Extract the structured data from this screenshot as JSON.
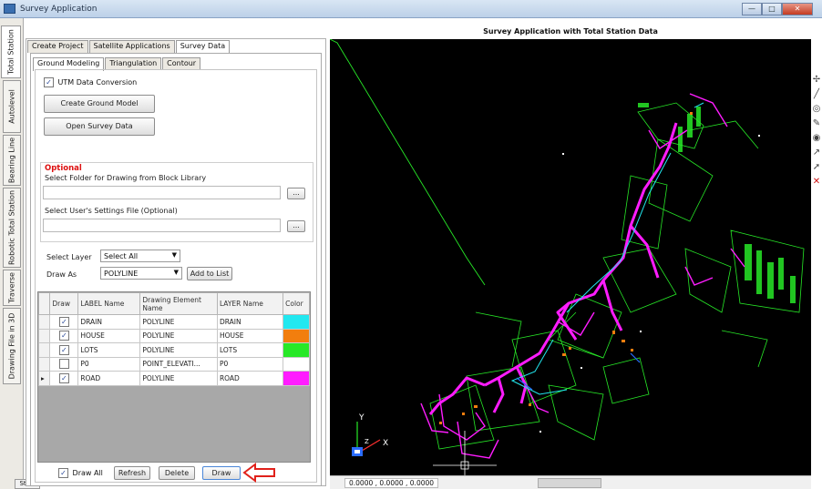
{
  "window": {
    "title": "Survey Application",
    "buttons": {
      "minimize": "—",
      "maximize": "□",
      "close": "✕"
    }
  },
  "side_tabs": [
    "Total Station",
    "Autolevel",
    "Bearing Line",
    "Robotic Total Station",
    "Traverse",
    "Drawing File in 3D"
  ],
  "start_button": "Start",
  "top_tabs": [
    "Create Project",
    "Satellite Applications",
    "Survey Data"
  ],
  "sub_tabs": [
    "Ground Modeling",
    "Triangulation",
    "Contour"
  ],
  "utm_label": "UTM Data Conversion",
  "utm_checked": "✓",
  "buttons": {
    "create_ground": "Create Ground Model",
    "open_survey": "Open Survey Data",
    "browse": "...",
    "add_to_list": "Add to List",
    "refresh": "Refresh",
    "delete": "Delete",
    "draw": "Draw"
  },
  "optional": {
    "title": "Optional",
    "folder_label": "Select Folder for Drawing from Block Library",
    "settings_label": "Select User's Settings File (Optional)"
  },
  "select_layer": {
    "label": "Select Layer",
    "value": "Select All"
  },
  "draw_as": {
    "label": "Draw As",
    "value": "POLYLINE"
  },
  "table": {
    "headers": [
      "Draw",
      "LABEL Name",
      "Drawing Element Name",
      "LAYER Name",
      "Color"
    ],
    "rows": [
      {
        "draw": "✓",
        "label": "DRAIN",
        "element": "POLYLINE",
        "layer": "DRAIN",
        "color": "#22e8f0"
      },
      {
        "draw": "✓",
        "label": "HOUSE",
        "element": "POLYLINE",
        "layer": "HOUSE",
        "color": "#f27e0e"
      },
      {
        "draw": "✓",
        "label": "LOTS",
        "element": "POLYLINE",
        "layer": "LOTS",
        "color": "#27e827"
      },
      {
        "draw": "",
        "label": "P0",
        "element": "POINT_ELEVATI...",
        "layer": "P0",
        "color": "#ffffff"
      },
      {
        "draw": "✓",
        "label": "ROAD",
        "element": "POLYLINE",
        "layer": "ROAD",
        "color": "#ff1cff"
      }
    ],
    "current_marker": "▸"
  },
  "draw_all": {
    "label": "Draw All",
    "checked": "✓"
  },
  "cad": {
    "title": "Survey Application with Total Station Data",
    "coords": "0.0000 , 0.0000 , 0.0000",
    "axis_y": "Y",
    "axis_x": "X",
    "axis_z": "Z"
  },
  "colors": {
    "drain": "#22e8f0",
    "house": "#f27e0e",
    "lots": "#27e827",
    "road": "#ff1cff",
    "extra": "#2a6cff",
    "callout": "#e0211b"
  }
}
